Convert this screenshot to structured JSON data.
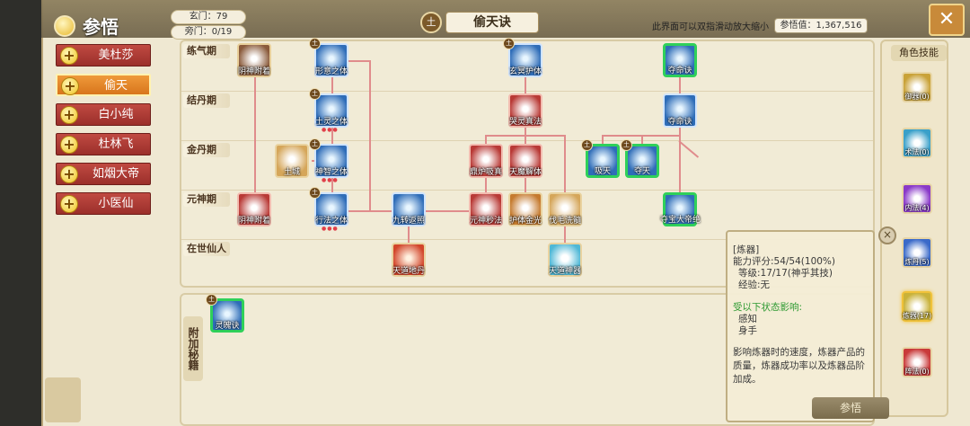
{
  "header": {
    "title": "参悟",
    "xuan_men": "玄门：79",
    "pang_men": "旁门：0/19",
    "element": "土",
    "skill_title": "偷天诀",
    "zoom_hint": "此界面可以双指滑动放大缩小",
    "enlighten_value": "参悟值：1,367,516"
  },
  "characters": [
    {
      "name": "美杜莎",
      "plus": "+"
    },
    {
      "name": "偷天",
      "plus": "+"
    },
    {
      "name": "白小纯",
      "plus": "+"
    },
    {
      "name": "杜林飞",
      "plus": "+"
    },
    {
      "name": "如烟大帝",
      "plus": "+"
    },
    {
      "name": "小医仙",
      "plus": "+"
    }
  ],
  "realms": [
    "练气期",
    "结丹期",
    "金丹期",
    "元神期",
    "在世仙人"
  ],
  "nodes": [
    {
      "label": "阴神附着",
      "badge": ""
    },
    {
      "label": "形意之体",
      "badge": "土"
    },
    {
      "label": "玄冥护体",
      "badge": "土"
    },
    {
      "label": "夺命诀",
      "badge": ""
    },
    {
      "label": "土灵之体",
      "badge": "土"
    },
    {
      "label": "哭灵真法",
      "badge": ""
    },
    {
      "label": "夺命诀",
      "badge": ""
    },
    {
      "label": "土城",
      "badge": ""
    },
    {
      "label": "神智之体",
      "badge": "土"
    },
    {
      "label": "鼎炉吸真",
      "badge": ""
    },
    {
      "label": "天魔解体",
      "badge": ""
    },
    {
      "label": "吸天",
      "badge": "土"
    },
    {
      "label": "夺天",
      "badge": "土"
    },
    {
      "label": "阴神附着",
      "badge": ""
    },
    {
      "label": "行法之体",
      "badge": "土"
    },
    {
      "label": "九转返照",
      "badge": ""
    },
    {
      "label": "元神秒法",
      "badge": ""
    },
    {
      "label": "护体金光",
      "badge": ""
    },
    {
      "label": "伐毛洗髓",
      "badge": ""
    },
    {
      "label": "夺宝大帝绝",
      "badge": ""
    },
    {
      "label": "天道地丹",
      "badge": ""
    },
    {
      "label": "天道神器",
      "badge": ""
    }
  ],
  "secret": {
    "tab_label": "附加秘籍",
    "item_label": "灵魄诀",
    "item_badge": "土"
  },
  "role_skills": {
    "title": "角色技能",
    "items": [
      {
        "label": "御器(0)"
      },
      {
        "label": "术法(0)"
      },
      {
        "label": "内法(4)"
      },
      {
        "label": "炼丹(5)"
      },
      {
        "label": "炼器(17)"
      },
      {
        "label": "阵法(0)"
      }
    ]
  },
  "tooltip": {
    "name": "[炼器]",
    "rating": "能力评分:54/54(100%)",
    "level": "等级:17/17(神乎其技)",
    "exp": "经验:无",
    "influence_head": "受以下状态影响:",
    "influence_items": [
      "感知",
      "身手"
    ],
    "description": "影响炼器时的速度，炼器产品的质量，炼器成功率以及炼器品阶加成。",
    "button": "参悟",
    "close": "×"
  },
  "close_main": "✕"
}
